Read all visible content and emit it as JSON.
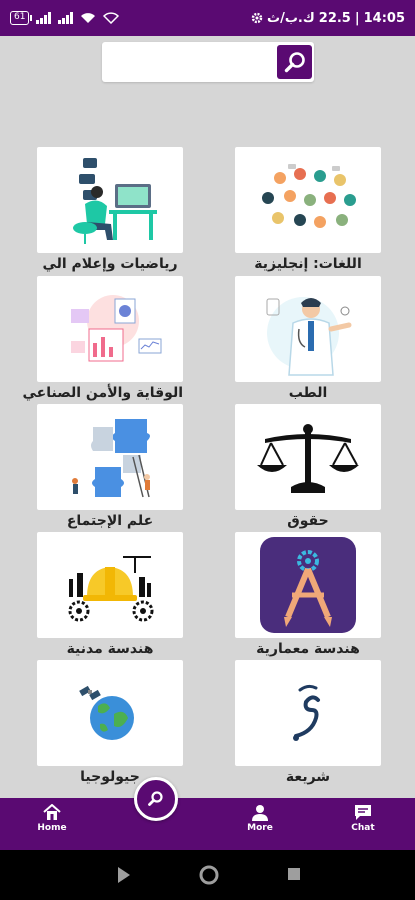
{
  "status_bar": {
    "time": "14:05",
    "separator": "|",
    "speed": "22.5",
    "speed_unit": "ك.ب/ث",
    "battery": "61"
  },
  "search": {
    "placeholder": "",
    "value": ""
  },
  "cards": [
    {
      "label": "رياضيات وإعلام الي",
      "image": "computer-programmer-illustration"
    },
    {
      "label": "اللغات: إنجليزية",
      "image": "world-people-languages-illustration"
    },
    {
      "label": "الوقاية والأمن الصناعي",
      "image": "industrial-dashboard-illustration"
    },
    {
      "label": "الطب",
      "image": "doctor-illustration"
    },
    {
      "label": "علم الإجتماع",
      "image": "puzzle-people-illustration"
    },
    {
      "label": "حقوق",
      "image": "scales-of-justice-icon"
    },
    {
      "label": "هندسة مدنية",
      "image": "hard-hat-gears-icon"
    },
    {
      "label": "هندسة معمارية",
      "image": "compass-gear-icon"
    },
    {
      "label": "جيولوجيا",
      "image": "earth-globe-satellite-icon"
    },
    {
      "label": "شريعة",
      "image": "arabic-calligraphy-icon"
    }
  ],
  "bottom_nav": {
    "home": "Home",
    "more": "More",
    "chat": "Chat"
  },
  "colors": {
    "brand": "#5a0a72",
    "background": "#d6d6d6"
  }
}
